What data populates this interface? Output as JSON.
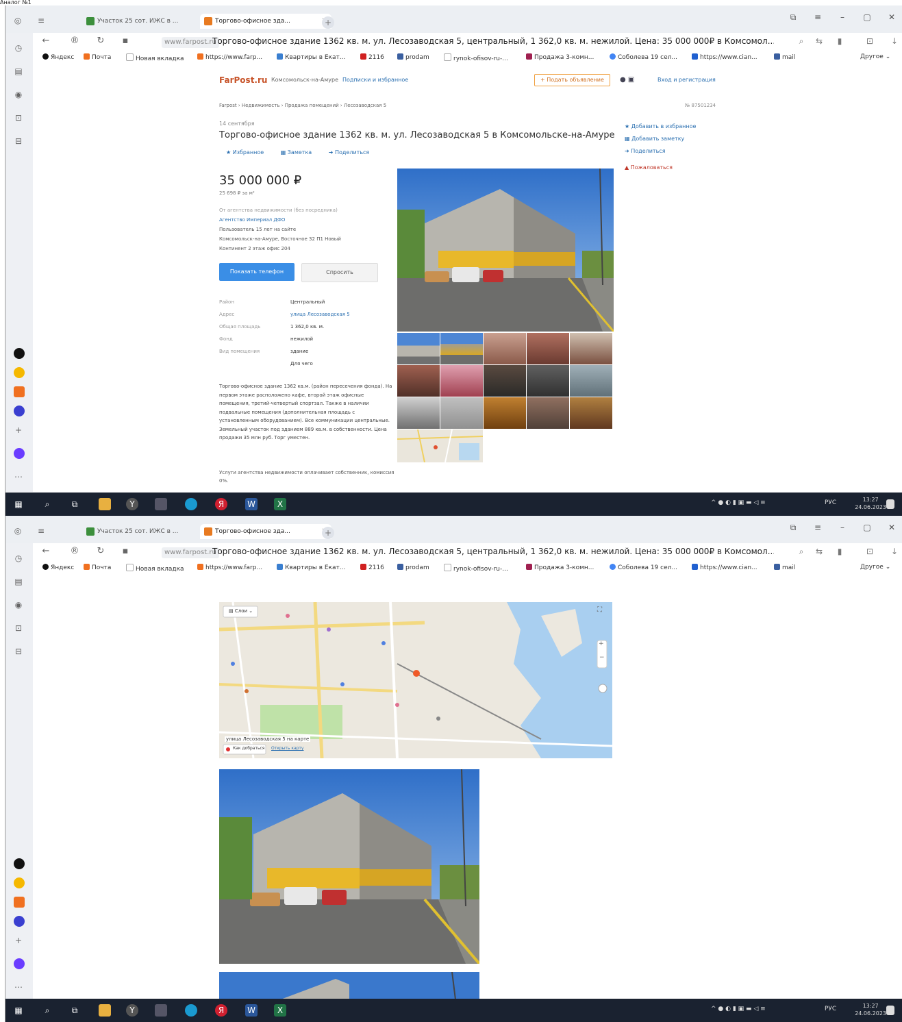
{
  "caption": "Аналог №1",
  "browser": {
    "tabs": [
      {
        "title": "Участок 25 сот. ИЖС в ...",
        "active": false
      },
      {
        "title": "Торгово-офисное зда...",
        "active": true
      }
    ],
    "domain": "www.farpost.ru",
    "page_title": "Торгово-офисное здание 1362 кв. м. ул. Лесозаводская 5, центральный, 1 362,0 кв. м. нежилой. Цена: 35 000 000₽ в Комсомол...",
    "bookmarks": [
      {
        "label": "Яндекс",
        "color": "#111"
      },
      {
        "label": "Почта",
        "color": "#f07020"
      },
      {
        "label": "Новая вкладка",
        "color": "#aaa"
      },
      {
        "label": "https://www.farp...",
        "color": "#f07020"
      },
      {
        "label": "Квартиры в Екат...",
        "color": "#3a7fd0"
      },
      {
        "label": "2116",
        "color": "#d02020"
      },
      {
        "label": "prodam",
        "color": "#3a5fa0"
      },
      {
        "label": "rynok-ofisov-ru-...",
        "color": "#aaa"
      },
      {
        "label": "Продажа 3-комн...",
        "color": "#a02050"
      },
      {
        "label": "Соболева 19 сел...",
        "color": "#4285f4"
      },
      {
        "label": "https://www.cian...",
        "color": "#2060d0"
      },
      {
        "label": "mail",
        "color": "#3a5fa0"
      },
      {
        "label": "Другое",
        "color": "#fff"
      }
    ]
  },
  "site": {
    "logo": "FarPost.ru",
    "city": "Комсомольск-на-Амуре",
    "subscribe": "Подписки и избранное",
    "post_ad": "+ Подать объявление",
    "login": "Вход и регистрация"
  },
  "ad": {
    "breadcrumb": "Farpost › Недвижимость › Продажа помещений › Лесозаводская 5",
    "id": "№ 87501234",
    "date": "14 сентября",
    "title": "Торгово-офисное здание 1362 кв. м. ул. Лесозаводская 5 в Комсомольске-на-Амуре",
    "actions": [
      "★ Избранное",
      "▦ Заметка",
      "➜ Поделиться"
    ],
    "side_actions": [
      "★ Добавить в избранное",
      "▦ Добавить заметку",
      "➜ Поделиться"
    ],
    "complain": "▲ Пожаловаться",
    "price": "35 000 000 ₽",
    "price_per_m2": "25 698 ₽ за м²",
    "seller_from": "От агентства недвижимости (без посредника)",
    "seller_name": "Агентство Империал ДФО",
    "seller_info": [
      "Пользователь 15 лет на сайте",
      "Комсомольск-на-Амуре, Восточное 32 П1 Новый",
      "Континент 2 этаж офис 204"
    ],
    "btn_phone": "Показать телефон",
    "btn_ask": "Спросить",
    "params": [
      {
        "k": "Район",
        "v": "Центральный",
        "link": false
      },
      {
        "k": "Адрес",
        "v": "улица Лесозаводская 5",
        "link": true
      },
      {
        "k": "Общая площадь",
        "v": "1 362,0 кв. м.",
        "link": false
      },
      {
        "k": "Фонд",
        "v": "нежилой",
        "link": false
      },
      {
        "k": "Вид помещения",
        "v": "здание",
        "link": false
      },
      {
        "k": "",
        "v": "Для чего",
        "link": false
      }
    ],
    "description": "Торгово-офисное здание 1362 кв.м. (район пересечения фонда). На первом этаже расположено кафе, второй этаж офисные помещения, третий-четвертый спортзал. Также в наличии подвальные помещения (дополнительная площадь с установленным оборудованием). Все коммуникации центральные. Земельный участок под зданием 889 кв.м. в собственности. Цена продажи 35 млн руб. Торг уместен.",
    "fee": "Услуги агентства недвижимости оплачивает собственник, комиссия 0%."
  },
  "map": {
    "layers": "Слои",
    "address_label": "улица Лесозаводская 5 на карте",
    "route": "Как добраться",
    "open_map": "Открыть карту"
  },
  "taskbar": {
    "lang": "РУС",
    "time": "13:27",
    "date": "24.06.2023"
  }
}
